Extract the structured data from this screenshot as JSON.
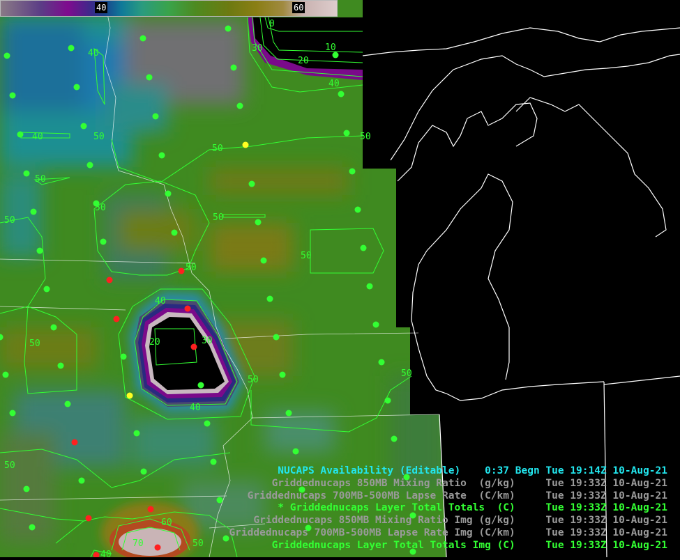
{
  "colorbar": {
    "labels": [
      "40",
      "60"
    ]
  },
  "map": {
    "contour_labels": {
      "c40a": "40",
      "c10": "10",
      "c20a": "20",
      "c30a": "30",
      "c0": "0",
      "c40b": "40",
      "c50a": "50",
      "c40c": "40",
      "c50b": "50",
      "c50c": "50",
      "c50d": "50",
      "c50e": "50",
      "c50f": "50",
      "c50g": "50",
      "c50h": "50",
      "c40d": "40",
      "c20b": "20",
      "c30b": "30",
      "c50i": "50",
      "c40e": "40",
      "c50j": "50",
      "c50k": "50",
      "c60": "60",
      "c70": "70",
      "c50l": "50",
      "c40f": "40",
      "c50m": "50",
      "c50n": "50"
    },
    "colors": {
      "contour": "#33ff33",
      "obs_good": "#33ff33",
      "obs_bad": "#ff2020",
      "obs_warn": "#ffff22",
      "border": "#ffffff",
      "field_base": "#3f8a20"
    }
  },
  "legend": {
    "lines": [
      {
        "text": "NUCAPS Availability (Editable)    0:37 Begn Tue 19:14Z 10-Aug-21",
        "color": "cyan"
      },
      {
        "text": "Griddednucaps 850MB Mixing Ratio  (g/kg)     Tue 19:33Z 10-Aug-21",
        "color": "grey"
      },
      {
        "text": "Griddednucaps 700MB-500MB Lapse Rate  (C/km)     Tue 19:33Z 10-Aug-21",
        "color": "grey"
      },
      {
        "text": "* Griddednucaps Layer Total Totals  (C)     Tue 19:33Z 10-Aug-21",
        "color": "green"
      },
      {
        "text": "Griddednucaps 850MB Mixing Ratio Img (g/kg)     Tue 19:33Z 10-Aug-21",
        "color": "grey"
      },
      {
        "text": "Griddednucaps 700MB-500MB Lapse Rate Img (C/km)     Tue 19:33Z 10-Aug-21",
        "color": "grey"
      },
      {
        "text": "Griddednucaps Layer Total Totals Img (C)     Tue 19:33Z 10-Aug-21",
        "color": "green"
      }
    ]
  }
}
